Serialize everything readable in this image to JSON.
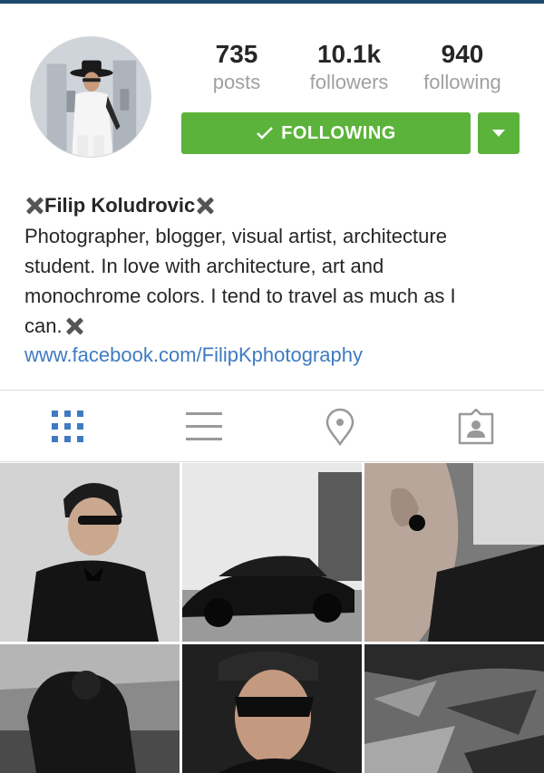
{
  "profile": {
    "stats": [
      {
        "value": "735",
        "label": "posts"
      },
      {
        "value": "10.1k",
        "label": "followers"
      },
      {
        "value": "940",
        "label": "following"
      }
    ],
    "follow_button_label": "FOLLOWING",
    "name": "Filip Koludrovic",
    "bio_lines": [
      "Photographer, blogger, visual artist, architecture",
      "student. In love with architecture, art and",
      "monochrome colors. I tend to travel as much as I",
      "can."
    ],
    "website": "www.facebook.com/FilipKphotography"
  },
  "icons": {
    "name_prefix": "x-mark-icon",
    "name_suffix": "x-mark-icon",
    "bio_suffix": "x-mark-icon",
    "follow_check": "checkmark-icon",
    "dropdown": "triangle-down-icon",
    "tabs": [
      "grid-icon",
      "list-icon",
      "location-pin-icon",
      "tagged-person-icon"
    ]
  },
  "colors": {
    "follow_green": "#5cb33b",
    "link_blue": "#3f7bc1",
    "active_tab_blue": "#3f7bc1",
    "inactive_tab_gray": "#999999",
    "stat_label_gray": "#a0a0a0"
  }
}
